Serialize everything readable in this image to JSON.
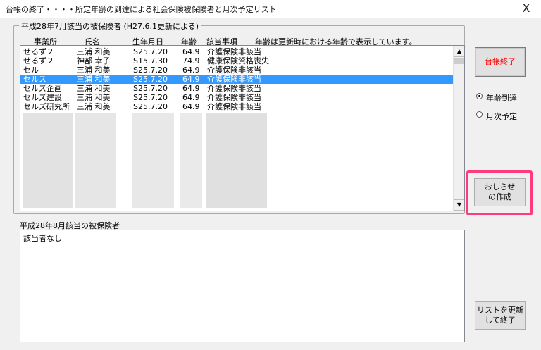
{
  "window": {
    "title": "台帳の終了・・・・所定年齢の到達による社会保険被保険者と月次予定リスト",
    "close_label": "X"
  },
  "upper_group": {
    "legend": "平成28年7月該当の被保険者 (H27.6.1更新による)",
    "headers": {
      "office": "事業所",
      "name": "氏名",
      "birthdate": "生年月日",
      "age": "年齢",
      "item": "該当事項",
      "note": "年齢は更新時における年齢で表示しています。"
    },
    "rows": [
      {
        "office": "せるず２",
        "name": "三浦 和美",
        "birthdate": "S25.7.20",
        "age": "64.9",
        "item": "介護保険非該当"
      },
      {
        "office": "せるず２",
        "name": "神部 幸子",
        "birthdate": "S15.7.30",
        "age": "74.9",
        "item": "健康保険資格喪失"
      },
      {
        "office": "セル",
        "name": "三浦 和美",
        "birthdate": "S25.7.20",
        "age": "64.9",
        "item": "介護保険非該当"
      },
      {
        "office": "セルス",
        "name": "三浦 和美",
        "birthdate": "S25.7.20",
        "age": "64.9",
        "item": "介護保険非該当"
      },
      {
        "office": "セルズ企画",
        "name": "三浦 和美",
        "birthdate": "S25.7.20",
        "age": "64.9",
        "item": "介護保険非該当"
      },
      {
        "office": "セルズ建設",
        "name": "三浦 和美",
        "birthdate": "S25.7.20",
        "age": "64.9",
        "item": "介護保険非該当"
      },
      {
        "office": "セルズ研究所",
        "name": "三浦 和美",
        "birthdate": "S25.7.20",
        "age": "64.9",
        "item": "介護保険非該当"
      }
    ],
    "selected_row": 3
  },
  "lower_group": {
    "label": "平成28年8月該当の被保険者",
    "text": "該当者なし"
  },
  "buttons": {
    "close_ledger": "台帳終了",
    "notice_line1": "おしらせ",
    "notice_line2": "の作成",
    "update_line1": "リストを更新",
    "update_line2": "して終了"
  },
  "radios": {
    "age_reached": "年齢到達",
    "monthly_plan": "月次予定",
    "selected": "age_reached"
  },
  "colors": {
    "selection": "#3399ff",
    "close_ledger_text": "#ff0000",
    "highlight_border": "#ff3b7f"
  }
}
